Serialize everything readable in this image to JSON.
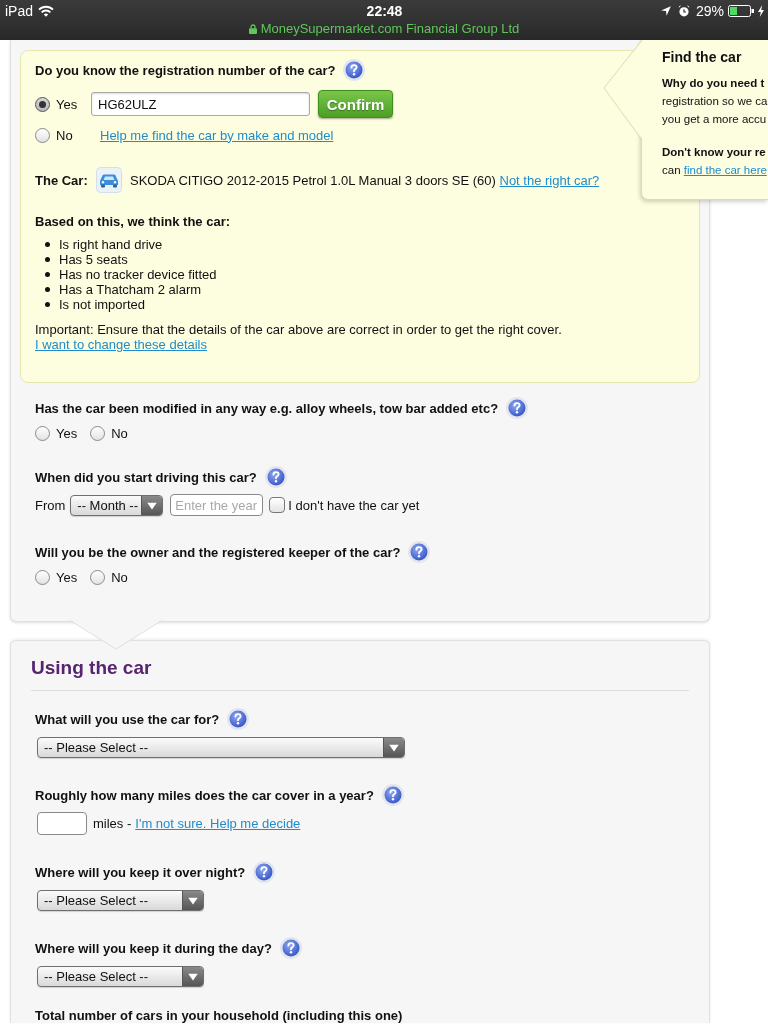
{
  "status_bar": {
    "device": "iPad",
    "time": "22:48",
    "battery": "29%",
    "site": "MoneySupermarket.com Financial Group Ltd"
  },
  "registration": {
    "question": "Do you know the registration number of the car?",
    "help": true,
    "options": [
      {
        "label": "Yes",
        "selected": true
      },
      {
        "label": "No",
        "selected": false
      }
    ],
    "value": "HG62ULZ",
    "confirm": "Confirm",
    "find_link": "Help me find the car by make and model"
  },
  "car": {
    "label": "The Car:",
    "description": "SKODA CITIGO 2012-2015 Petrol 1.0L Manual 3 doors SE (60)",
    "link": "Not the right car?"
  },
  "assumptions": {
    "heading": "Based on this, we think the car:",
    "items": [
      "Is right hand drive",
      "Has 5 seats",
      "Has no tracker device fitted",
      "Has a Thatcham 2 alarm",
      "Is not imported"
    ]
  },
  "important": {
    "text": "Important: Ensure that the details of the car above are correct in order to get the right cover.",
    "link": "I want to change these details"
  },
  "questions": [
    {
      "kind": "radio",
      "question": "Has the car been modified in any way e.g. alloy wheels, tow bar added etc?",
      "help": true,
      "options": [
        {
          "label": "Yes",
          "selected": false
        },
        {
          "label": "No",
          "selected": false
        }
      ]
    },
    {
      "kind": "date",
      "question": "When did you start driving this car?",
      "help": true,
      "prefix": "From",
      "month": "-- Month --",
      "year_placeholder": "Enter the year",
      "checkbox": {
        "label": "I don't have the car yet",
        "checked": false
      }
    },
    {
      "kind": "radio",
      "question": "Will you be the owner and the registered keeper of the car?",
      "help": true,
      "options": [
        {
          "label": "Yes",
          "selected": false
        },
        {
          "label": "No",
          "selected": false
        }
      ]
    }
  ],
  "using_the_car": {
    "title": "Using the car",
    "questions": [
      {
        "kind": "wide-select",
        "question": "What will you use the car for?",
        "help": true,
        "value": "-- Please Select --"
      },
      {
        "kind": "miles",
        "question": "Roughly how many miles does the car cover in a year?",
        "help": true,
        "unit": "miles -",
        "link": "I'm not sure. Help me decide"
      },
      {
        "kind": "select",
        "question": "Where will you keep it over night?",
        "help": true,
        "value": "-- Please Select --"
      },
      {
        "kind": "select",
        "question": "Where will you keep it during the day?",
        "help": true,
        "value": "-- Please Select --"
      },
      {
        "kind": "question",
        "question": "Total number of cars in your household (including this one)",
        "help": false
      }
    ]
  },
  "popover": {
    "title": "Find the car",
    "sections": [
      {
        "heading": "Why do you need t",
        "lines": [
          {
            "text": "registration so we ca"
          },
          {
            "text": "you get a more accu"
          }
        ]
      },
      {
        "heading": "Don't know your re",
        "lines": [
          {
            "text": "can",
            "link": "find the car here"
          }
        ]
      }
    ]
  }
}
